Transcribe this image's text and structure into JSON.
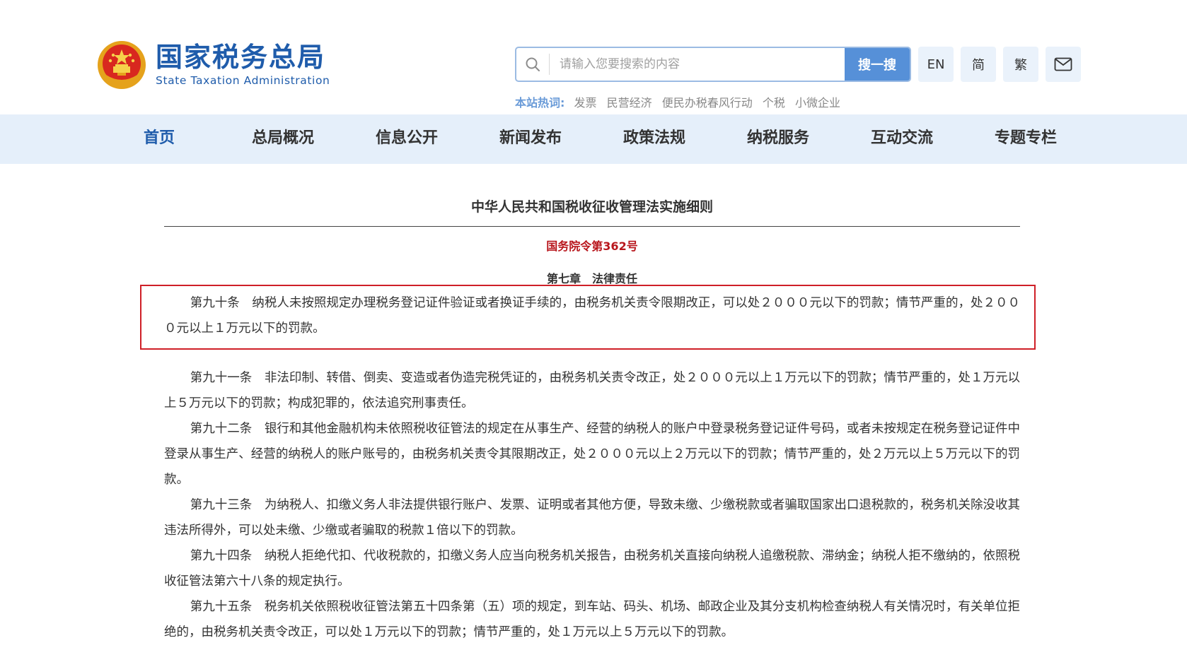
{
  "header": {
    "logo_cn": "国家税务总局",
    "logo_en": "State Taxation Administration",
    "search": {
      "placeholder": "请输入您要搜索的内容",
      "button_label": "搜一搜"
    },
    "tools": {
      "en_label": "EN",
      "simplified_label": "简",
      "traditional_label": "繁"
    },
    "hot": {
      "label": "本站热词:",
      "words": [
        "发票",
        "民营经济",
        "便民办税春风行动",
        "个税",
        "小微企业"
      ]
    }
  },
  "nav": {
    "items": [
      "首页",
      "总局概况",
      "信息公开",
      "新闻发布",
      "政策法规",
      "纳税服务",
      "互动交流",
      "专题专栏"
    ]
  },
  "article": {
    "title": "中华人民共和国税收征收管理法实施细则",
    "decree": "国务院令第362号",
    "chapter": "第七章　法律责任",
    "paragraphs": [
      "第九十条　纳税人未按照规定办理税务登记证件验证或者换证手续的，由税务机关责令限期改正，可以处２０００元以下的罚款；情节严重的，处２０００元以上１万元以下的罚款。",
      "第九十一条　非法印制、转借、倒卖、变造或者伪造完税凭证的，由税务机关责令改正，处２０００元以上１万元以下的罚款；情节严重的，处１万元以上５万元以下的罚款；构成犯罪的，依法追究刑事责任。",
      "第九十二条　银行和其他金融机构未依照税收征管法的规定在从事生产、经营的纳税人的账户中登录税务登记证件号码，或者未按规定在税务登记证件中登录从事生产、经营的纳税人的账户账号的，由税务机关责令其限期改正，处２０００元以上２万元以下的罚款；情节严重的，处２万元以上５万元以下的罚款。",
      "第九十三条　为纳税人、扣缴义务人非法提供银行账户、发票、证明或者其他方便，导致未缴、少缴税款或者骗取国家出口退税款的，税务机关除没收其违法所得外，可以处未缴、少缴或者骗取的税款１倍以下的罚款。",
      "第九十四条　纳税人拒绝代扣、代收税款的，扣缴义务人应当向税务机关报告，由税务机关直接向纳税人追缴税款、滞纳金；纳税人拒不缴纳的，依照税收征管法第六十八条的规定执行。",
      "第九十五条　税务机关依照税收征管法第五十四条第（五）项的规定，到车站、码头、机场、邮政企业及其分支机构检查纳税人有关情况时，有关单位拒绝的，由税务机关责令改正，可以处１万元以下的罚款；情节严重的，处１万元以上５万元以下的罚款。"
    ]
  }
}
